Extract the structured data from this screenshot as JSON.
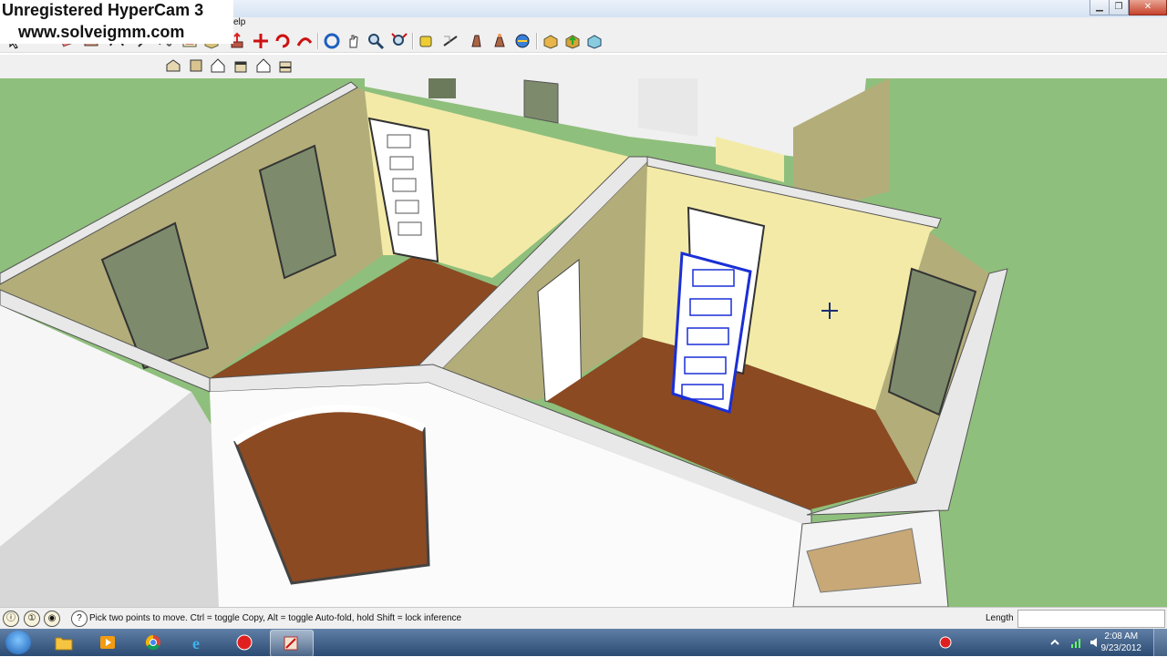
{
  "watermark": {
    "line1": "Unregistered HyperCam 3",
    "line2": "www.solveigmm.com"
  },
  "menubar": {
    "visible_fragment": "elp"
  },
  "window_controls": [
    "minimize-icon",
    "restore-icon",
    "close-icon"
  ],
  "toolbar": {
    "row1_icons": [
      "select",
      "component",
      "paint-bucket",
      "eraser",
      "rectangle",
      "circle",
      "arc",
      "line",
      "freehand",
      "offset",
      "push-pull",
      "move",
      "rotate",
      "follow-me",
      "scale",
      "orbit",
      "pan",
      "zoom",
      "zoom-window",
      "zoom-extents",
      "tape-measure",
      "dimension",
      "protractor",
      "axes",
      "text",
      "3d-text",
      "walk",
      "look-around",
      "position-camera",
      "section-plane",
      "get-models",
      "share-model",
      "photo-textures"
    ],
    "row2_icons": [
      "iso-view",
      "top-view",
      "front-view",
      "right-view",
      "back-view",
      "left-view"
    ]
  },
  "scene": {
    "floor_color": "#8b4a22",
    "wall_light": "#f3eaa8",
    "wall_dark": "#b3ad7a",
    "ground": "#8fbf7c",
    "selection": "#1a2fd6"
  },
  "statusbar": {
    "hint": "Pick two points to move.  Ctrl = toggle Copy, Alt = toggle Auto-fold, hold Shift = lock inference",
    "measure_label": "Length",
    "measure_value": ""
  },
  "taskbar": {
    "apps": [
      "windows-explorer",
      "media-player",
      "chrome",
      "internet-explorer",
      "hypercam",
      "sketchup"
    ],
    "active_app": "sketchup",
    "time": "2:08 AM",
    "date": "9/23/2012"
  }
}
